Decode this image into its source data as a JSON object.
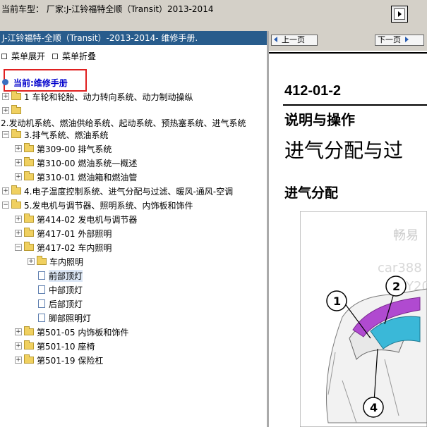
{
  "topbar": {
    "title": "当前车型：   厂家:J-江铃福特全顺（Transit）2013-2014"
  },
  "left": {
    "manual_header": "J-江铃福特-全顺（Transit）-2013-2014- 维修手册.",
    "expand_label": "菜单展开",
    "collapse_label": "菜单折叠",
    "current_label": "当前:维修手册",
    "tree": [
      {
        "label": "1 车轮和轮胎、动力转向系统、动力制动操纵",
        "exp": "+",
        "icon": "folder"
      },
      {
        "label": "",
        "exp": "+",
        "icon": "folder"
      },
      {
        "label": "2.发动机系统、燃油供给系统、起动系统、预热塞系统、进气系统",
        "exp": "",
        "icon": ""
      },
      {
        "label": "3.排气系统、燃油系统",
        "exp": "−",
        "icon": "folder"
      },
      {
        "label": "第309-00 排气系统",
        "exp": "+",
        "icon": "folder"
      },
      {
        "label": "第310-00 燃油系统—概述",
        "exp": "+",
        "icon": "folder"
      },
      {
        "label": "第310-01 燃油箱和燃油管",
        "exp": "+",
        "icon": "folder"
      },
      {
        "label": "4.电子温度控制系统、进气分配与过滤、暖风-通风-空调",
        "exp": "+",
        "icon": "folder"
      },
      {
        "label": "5.发电机与调节器、照明系统、内饰板和饰件",
        "exp": "−",
        "icon": "folder"
      },
      {
        "label": "第414-02 发电机与调节器",
        "exp": "+",
        "icon": "folder"
      },
      {
        "label": "第417-01 外部照明",
        "exp": "+",
        "icon": "folder"
      },
      {
        "label": "第417-02 车内照明",
        "exp": "−",
        "icon": "folder"
      },
      {
        "label": "车内照明",
        "exp": "+",
        "icon": "folder"
      },
      {
        "label": "前部顶灯",
        "exp": "",
        "icon": "doc"
      },
      {
        "label": "中部顶灯",
        "exp": "",
        "icon": "doc"
      },
      {
        "label": "后部顶灯",
        "exp": "",
        "icon": "doc"
      },
      {
        "label": "脚部照明灯",
        "exp": "",
        "icon": "doc"
      },
      {
        "label": "第501-05 内饰板和饰件",
        "exp": "+",
        "icon": "folder"
      },
      {
        "label": "第501-10 座椅",
        "exp": "+",
        "icon": "folder"
      },
      {
        "label": "第501-19 保险杠",
        "exp": "+",
        "icon": "folder"
      }
    ]
  },
  "right": {
    "prev_label": "上一页",
    "next_label": "下一页",
    "doc_code": "412-01-2",
    "section": "说明与操作",
    "title": "进气分配与过",
    "subtitle": "进气分配",
    "callouts": [
      "1",
      "2",
      "4"
    ],
    "watermark_lines": [
      "畅易",
      "car388",
      "Y20"
    ]
  },
  "colors": {
    "header_bg": "#285c8c",
    "current_text": "#0000cc",
    "highlight_border": "#e02020",
    "purple_part": "#b04ad0",
    "cyan_part": "#3ab8d8"
  }
}
